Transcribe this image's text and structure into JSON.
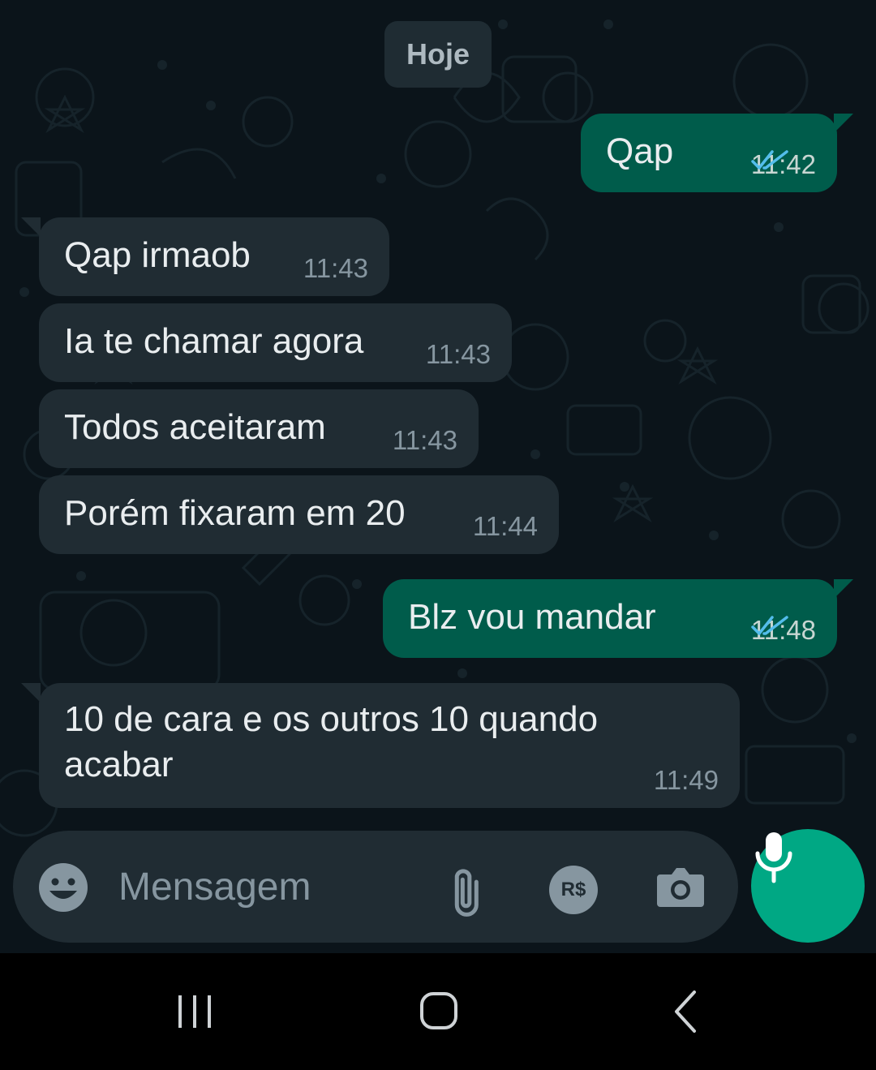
{
  "date_chip": "Hoje",
  "messages": [
    {
      "direction": "out",
      "text": "Qap",
      "time": "11:42",
      "status": "read"
    },
    {
      "direction": "in",
      "text": "Qap irmaob",
      "time": "11:43"
    },
    {
      "direction": "in",
      "text": "Ia te chamar agora",
      "time": "11:43"
    },
    {
      "direction": "in",
      "text": "Todos aceitaram",
      "time": "11:43"
    },
    {
      "direction": "in",
      "text": "Porém fixaram em 20",
      "time": "11:44"
    },
    {
      "direction": "out",
      "text": "Blz vou mandar",
      "time": "11:48",
      "status": "read"
    },
    {
      "direction": "in",
      "text_line1": "10 de cara e os outros 10 quando",
      "text_line2": "acabar",
      "time": "11:49"
    }
  ],
  "composer": {
    "placeholder": "Mensagem",
    "payment_label": "R$",
    "icons": [
      "emoji-icon",
      "paperclip-icon",
      "payment-icon",
      "camera-icon",
      "mic-icon"
    ]
  },
  "navbar": {
    "icons": [
      "recent-apps-icon",
      "home-icon",
      "back-icon"
    ]
  },
  "colors": {
    "background": "#0b141a",
    "incoming_bubble": "#202c33",
    "outgoing_bubble": "#005c4b",
    "accent": "#00a884",
    "read_ticks": "#53bdeb",
    "secondary_text": "#8696a0"
  }
}
